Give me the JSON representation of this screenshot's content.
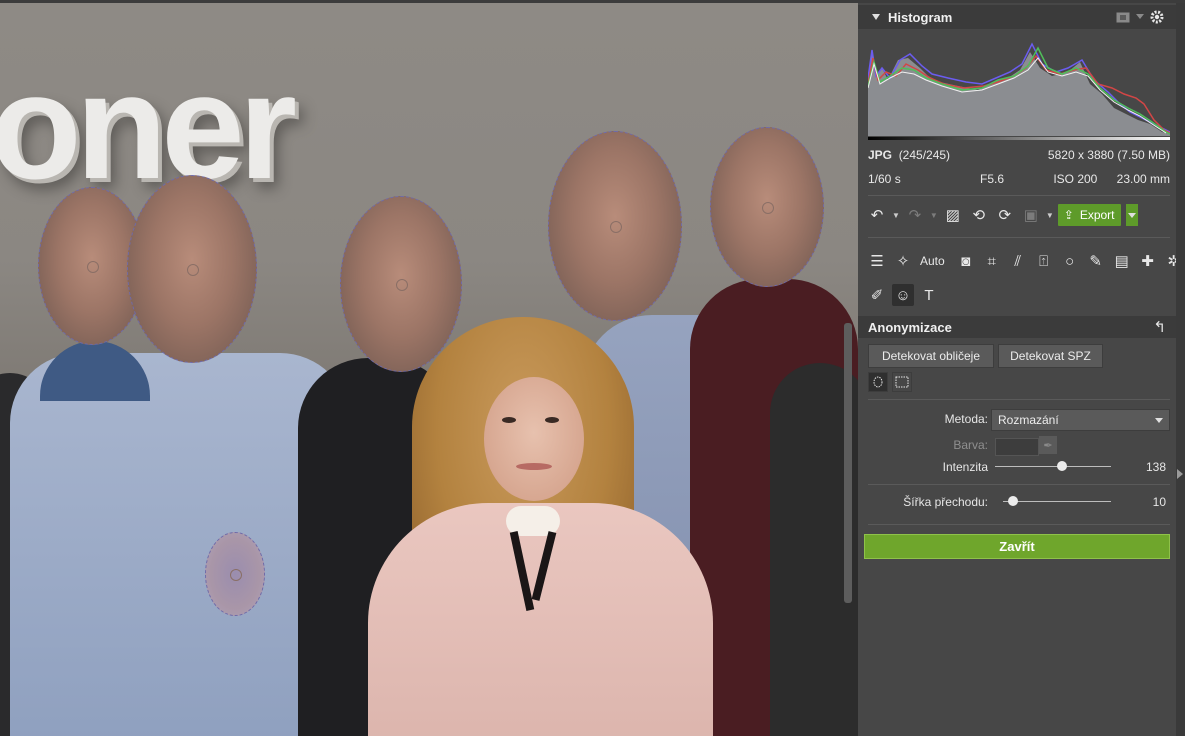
{
  "photo": {
    "logo_text": "oner"
  },
  "histogram": {
    "title": "Histogram",
    "format": "JPG",
    "count": "(245/245)",
    "dimensions": "5820 x 3880 (7.50 MB)",
    "shutter": "1/60 s",
    "aperture": "F5.6",
    "iso": "ISO 200",
    "focal": "23.00 mm"
  },
  "toolbar": {
    "export_label": "Export",
    "auto_label": "Auto"
  },
  "anonymize": {
    "title": "Anonymizace",
    "detect_faces": "Detekovat obličeje",
    "detect_plates": "Detekovat SPZ",
    "method_label": "Metoda:",
    "method_value": "Rozmazání",
    "color_label": "Barva:",
    "intensity_label": "Intenzita",
    "intensity_value": "138",
    "intensity_fraction": 0.58,
    "transition_label": "Šířka přechodu:",
    "transition_value": "10",
    "transition_fraction": 0.09,
    "close_label": "Zavřít"
  },
  "colors": {
    "accent": "#6fa62c",
    "panel": "#474747",
    "header": "#3b3b3b"
  }
}
